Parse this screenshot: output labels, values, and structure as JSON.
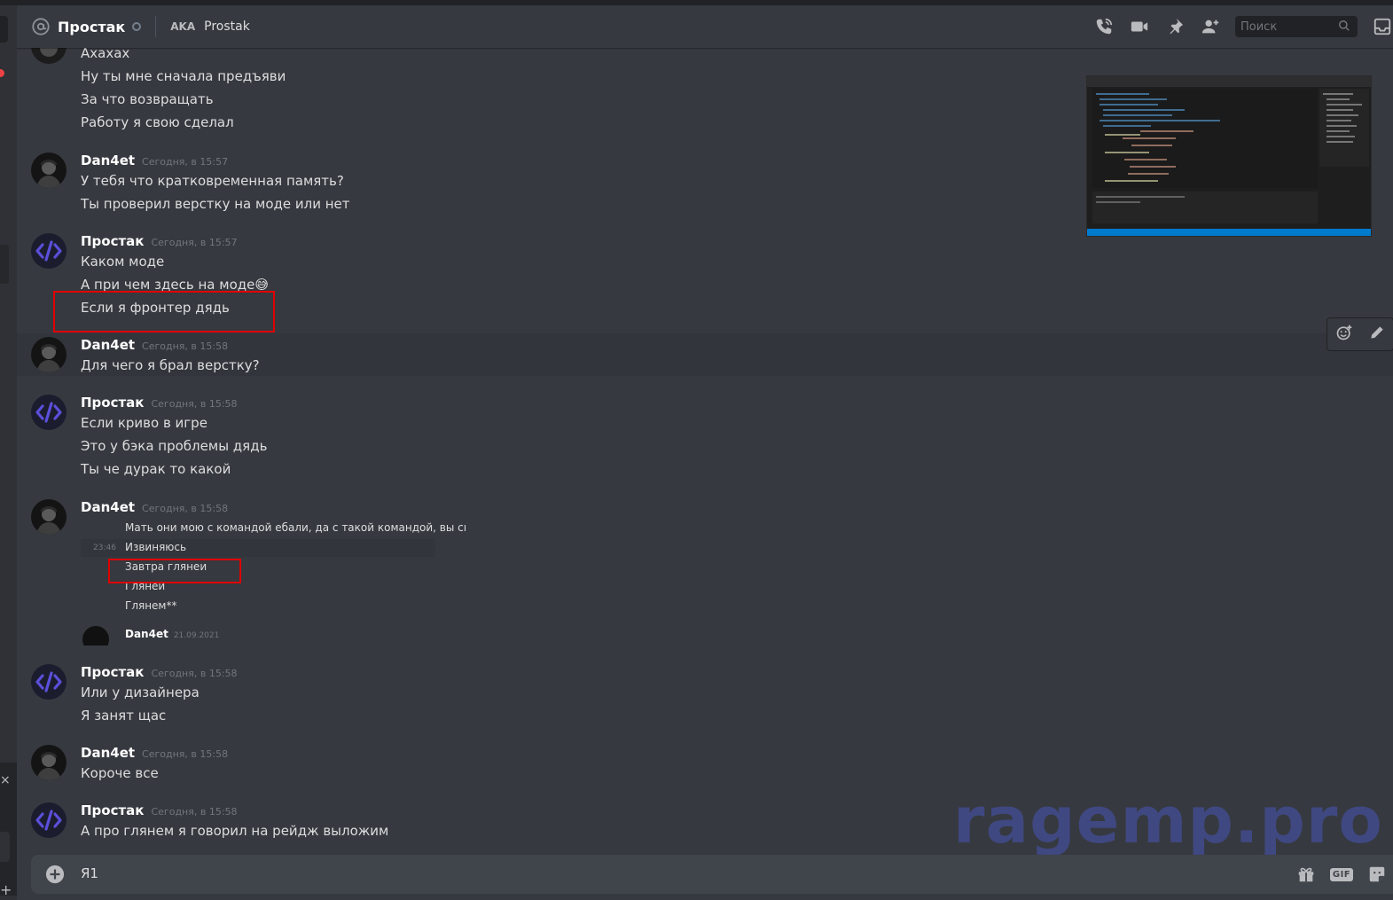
{
  "header": {
    "channel_name": "Простак",
    "aka_label": "AKA",
    "aka_name": "Prostak",
    "search_placeholder": "Поиск"
  },
  "icons": [
    "at-icon",
    "phone-icon",
    "video-icon",
    "pin-icon",
    "add-friend-icon",
    "search-icon",
    "inbox-icon",
    "add-reaction-icon",
    "edit-icon",
    "upload-icon",
    "gift-icon",
    "gif-icon",
    "sticker-icon"
  ],
  "messages": {
    "g0": {
      "lines": [
        "Ахахах",
        "Ну ты мне сначала предъяви",
        "За что возвращать",
        "Работу я свою сделал"
      ]
    },
    "g1": {
      "author": "Dan4et",
      "time": "Сегодня, в 15:57",
      "lines": [
        "У тебя что кратковременная память?",
        "Ты проверил верстку на моде или нет"
      ]
    },
    "g2": {
      "author": "Простак",
      "time": "Сегодня, в 15:57",
      "lines": [
        "Каком моде",
        "А при чем здесь на моде😅",
        "Если я фронтер дядь"
      ]
    },
    "g3": {
      "author": "Dan4et",
      "time": "Сегодня, в 15:58",
      "lines": [
        "Для чего я брал верстку?"
      ]
    },
    "g4": {
      "author": "Простак",
      "time": "Сегодня, в 15:58",
      "lines": [
        "Если криво в игре",
        "Это у бэка проблемы дядь",
        "Ты че дурак то какой"
      ]
    },
    "g5": {
      "author": "Dan4et",
      "time": "Сегодня, в 15:58"
    },
    "g6": {
      "author": "Простак",
      "time": "Сегодня, в 15:58",
      "lines": [
        "Или у дизайнера",
        "Я занят щас"
      ]
    },
    "g7": {
      "author": "Dan4et",
      "time": "Сегодня, в 15:58",
      "lines": [
        "Короче все"
      ]
    },
    "g8": {
      "author": "Простак",
      "time": "Сегодня, в 15:58",
      "lines": [
        "А про глянем я говорил на рейдж выложим"
      ]
    }
  },
  "embed": {
    "lines": [
      "Мать они мою с командой ебали, да с такой командой, вы сı",
      "Извиняюсь",
      "Завтра глянеи",
      "Глянеи",
      "Глянем**"
    ],
    "timestamp": "23:46",
    "author": "Dan4et",
    "date": "21.09.2021"
  },
  "watermark": "ragemp.pro",
  "composer": {
    "value": "Я1"
  },
  "colors": {
    "background": "#36393f",
    "header": "#36393f",
    "composer": "#40444b",
    "highlight_box": "#e00000",
    "watermark": "#3f4880",
    "code_avatar": "#5b4fd9"
  }
}
